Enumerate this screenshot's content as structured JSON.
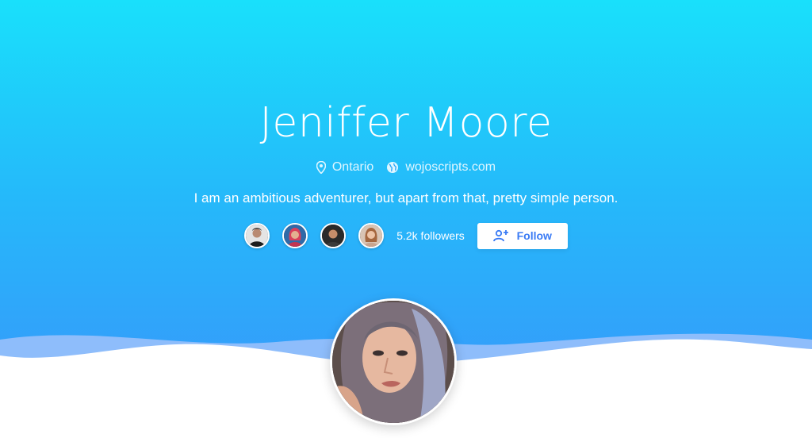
{
  "profile": {
    "name": "Jeniffer Moore",
    "location": "Ontario",
    "website": "wojoscripts.com",
    "bio": "I am an ambitious adventurer, but apart from that, pretty simple person.",
    "followers_label": "5.2k followers",
    "follow_label": "Follow"
  },
  "icons": {
    "location": "map-pin-icon",
    "website": "globe-icon",
    "follow": "user-add-icon"
  },
  "colors": {
    "gradient_top": "#19e0fb",
    "gradient_bottom": "#3a92fb",
    "button_text": "#3a7bf5",
    "wave_light": "#8ebdfb"
  }
}
